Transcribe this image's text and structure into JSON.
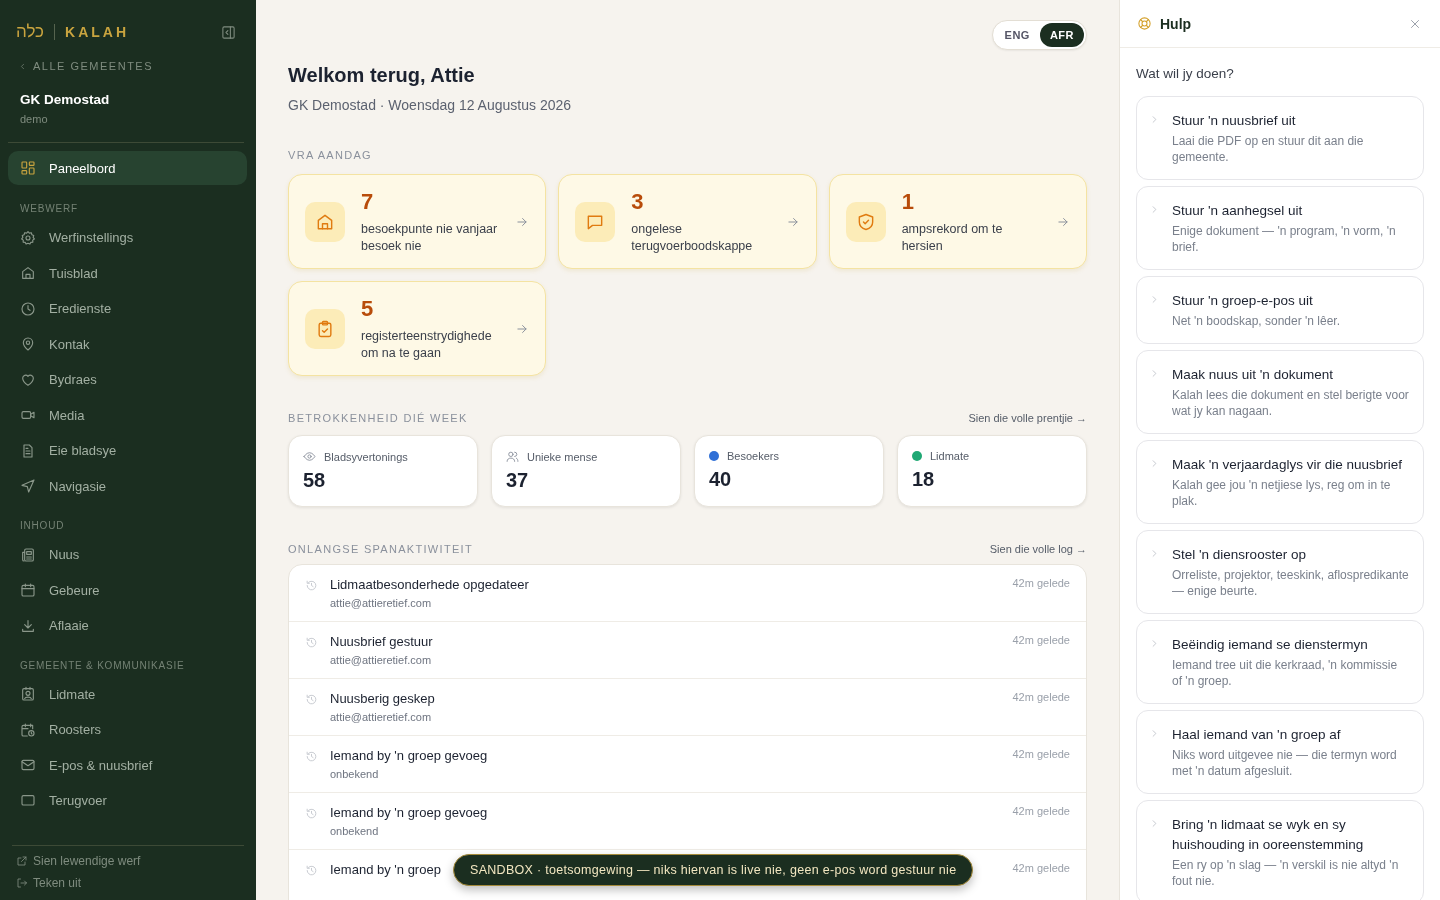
{
  "sidebar": {
    "logo_mark": "כלה",
    "logo_text": "KALAH",
    "back_link": "ALLE GEMEENTES",
    "org_name": "GK Demostad",
    "org_slug": "demo",
    "sections": [
      {
        "items": [
          {
            "label": "Paneelbord",
            "selected": true
          }
        ]
      },
      {
        "heading": "WEBWERF",
        "items": [
          {
            "label": "Werfinstellings",
            "selected": false
          },
          {
            "label": "Tuisblad",
            "selected": false
          },
          {
            "label": "Eredienste",
            "selected": false
          },
          {
            "label": "Kontak",
            "selected": false
          },
          {
            "label": "Bydraes",
            "selected": false
          },
          {
            "label": "Media",
            "selected": false
          },
          {
            "label": "Eie bladsye",
            "selected": false
          },
          {
            "label": "Navigasie",
            "selected": false
          }
        ]
      },
      {
        "heading": "INHOUD",
        "items": [
          {
            "label": "Nuus",
            "selected": false
          },
          {
            "label": "Gebeure",
            "selected": false
          },
          {
            "label": "Aflaaie",
            "selected": false
          }
        ]
      },
      {
        "heading": "GEMEENTE & KOMMUNIKASIE",
        "items": [
          {
            "label": "Lidmate",
            "selected": false
          },
          {
            "label": "Roosters",
            "selected": false
          },
          {
            "label": "E-pos & nuusbrief",
            "selected": false
          },
          {
            "label": "Terugvoer",
            "selected": false
          }
        ]
      }
    ],
    "footer_links": [
      "Sien lewendige werf",
      "Teken uit"
    ]
  },
  "language_toggle": [
    {
      "label": "ENG",
      "selected": false
    },
    {
      "label": "AFR",
      "selected": true
    }
  ],
  "main": {
    "title": "Welkom terug, Attie",
    "subtitle": "GK Demostad · Woensdag 12 Augustus 2026",
    "attention": {
      "heading": "VRA AANDAG",
      "cards": [
        {
          "count": "7",
          "label": "besoekpunte nie vanjaar besoek nie"
        },
        {
          "count": "3",
          "label": "ongelese terugvoerboodskappe"
        },
        {
          "count": "1",
          "label": "ampsrekord om te hersien"
        },
        {
          "count": "5",
          "label": "registerteenstrydighede om na te gaan"
        }
      ]
    },
    "engagement": {
      "heading": "BETROKKENHEID DIÉ WEEK",
      "link": "Sien die volle prentjie →",
      "stats": [
        {
          "kind": "icon",
          "label": "Bladsyvertonings",
          "value": "58"
        },
        {
          "kind": "icon",
          "label": "Unieke mense",
          "value": "37"
        },
        {
          "kind": "dot",
          "label": "Besoekers",
          "value": "40",
          "color": "#2f6fd6"
        },
        {
          "kind": "dot",
          "label": "Lidmate",
          "value": "18",
          "color": "#1fa874"
        }
      ]
    },
    "activity": {
      "heading": "ONLANGSE SPANAKTIWITEIT",
      "link": "Sien die volle log →",
      "rows": [
        {
          "title": "Lidmaatbesonderhede opgedateer",
          "user": "attie@attieretief.com",
          "time": "42m gelede"
        },
        {
          "title": "Nuusbrief gestuur",
          "user": "attie@attieretief.com",
          "time": "42m gelede"
        },
        {
          "title": "Nuusberig geskep",
          "user": "attie@attieretief.com",
          "time": "42m gelede"
        },
        {
          "title": "Iemand by 'n groep gevoeg",
          "user": "onbekend",
          "time": "42m gelede"
        },
        {
          "title": "Iemand by 'n groep gevoeg",
          "user": "onbekend",
          "time": "42m gelede"
        },
        {
          "title": "Iemand by 'n groep",
          "time": "42m gelede"
        }
      ]
    }
  },
  "toast": "SANDBOX · toetsomgewing — niks hiervan is live nie, geen e-pos word gestuur nie",
  "help": {
    "title": "Hulp",
    "question": "Wat wil jy doen?",
    "items": [
      {
        "title": "Stuur 'n nuusbrief uit",
        "desc": "Laai die PDF op en stuur dit aan die gemeente."
      },
      {
        "title": "Stuur 'n aanhegsel uit",
        "desc": "Enige dokument — 'n program, 'n vorm, 'n brief."
      },
      {
        "title": "Stuur 'n groep-e-pos uit",
        "desc": "Net 'n boodskap, sonder 'n lêer."
      },
      {
        "title": "Maak nuus uit 'n dokument",
        "desc": "Kalah lees die dokument en stel berigte voor wat jy kan nagaan."
      },
      {
        "title": "Maak 'n verjaardaglys vir die nuusbrief",
        "desc": "Kalah gee jou 'n netjiese lys, reg om in te plak."
      },
      {
        "title": "Stel 'n diensrooster op",
        "desc": "Orreliste, projektor, teeskink, aflospredikante — enige beurte."
      },
      {
        "title": "Beëindig iemand se dienstermyn",
        "desc": "Iemand tree uit die kerkraad, 'n kommissie of 'n groep."
      },
      {
        "title": "Haal iemand van 'n groep af",
        "desc": "Niks word uitgevee nie — die termyn word met 'n datum afgesluit."
      },
      {
        "title": "Bring 'n lidmaat se wyk en sy huishouding in ooreenstemming",
        "desc": "Een ry op 'n slag — 'n verskil is nie altyd 'n fout nie."
      }
    ]
  }
}
